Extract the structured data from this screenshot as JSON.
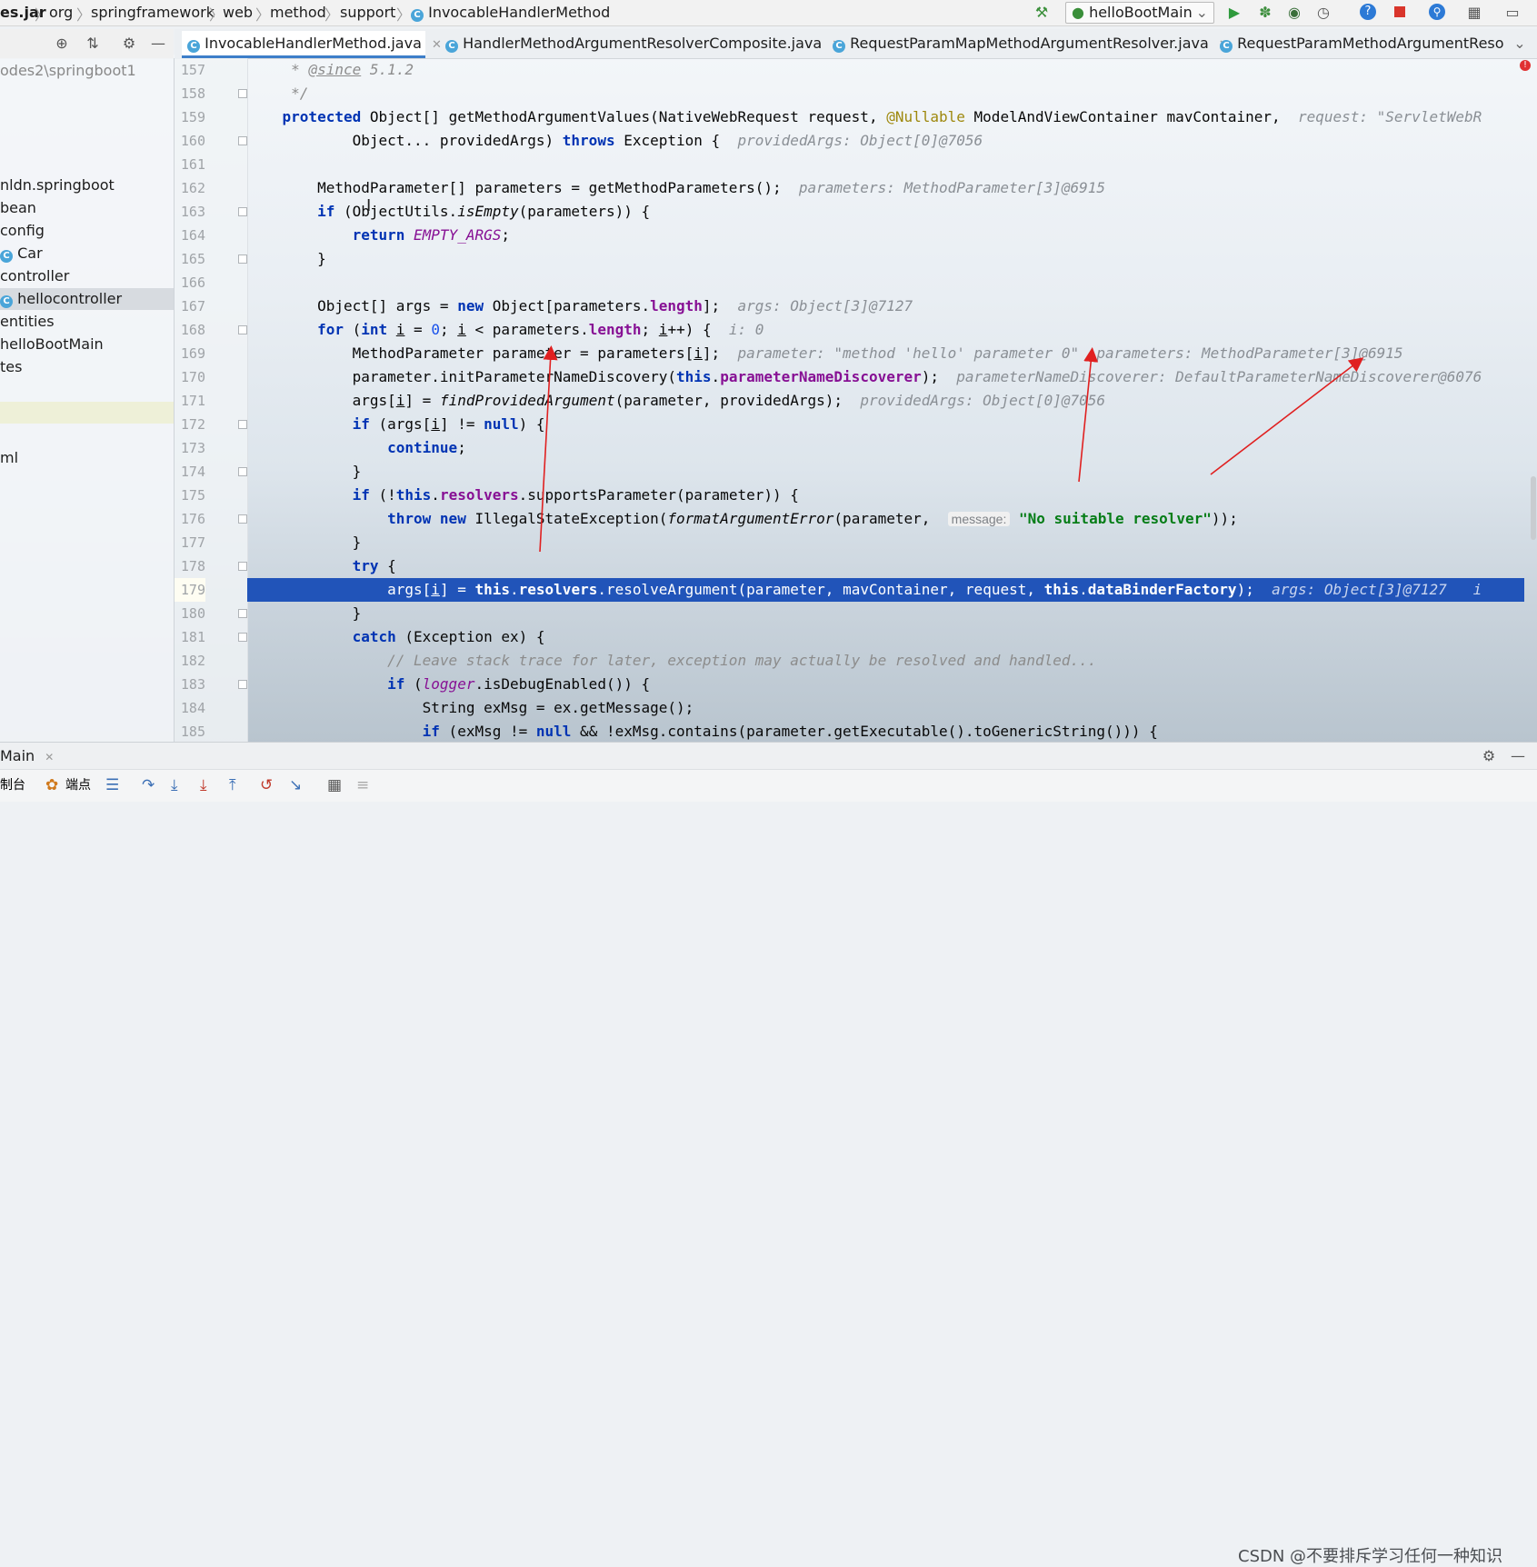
{
  "breadcrumb": {
    "items": [
      "es.jar",
      "org",
      "springframework",
      "web",
      "method",
      "support",
      "InvocableHandlerMethod"
    ],
    "separator": "〉"
  },
  "toolbar": {
    "run_config": "helloBootMain",
    "icons": [
      "hammer-icon",
      "run-icon",
      "debug-icon",
      "coverage-icon",
      "profile-icon",
      "help-icon",
      "stop-icon",
      "search-everywhere-icon",
      "project-structure-icon",
      "terminal-icon"
    ]
  },
  "sidebar": {
    "path": "odes2\\springboot1",
    "items": [
      {
        "label": "nldn.springboot"
      },
      {
        "label": "bean"
      },
      {
        "label": "config"
      },
      {
        "label": "Car"
      },
      {
        "label": "controller"
      },
      {
        "label": "hellocontroller"
      },
      {
        "label": "entities"
      },
      {
        "label": "helloBootMain"
      },
      {
        "label": "tes"
      },
      {
        "label": "ml"
      }
    ]
  },
  "tabs": [
    {
      "label": "InvocableHandlerMethod.java",
      "active": true
    },
    {
      "label": "HandlerMethodArgumentResolverComposite.java",
      "active": false
    },
    {
      "label": "RequestParamMapMethodArgumentResolver.java",
      "active": false
    },
    {
      "label": "RequestParamMethodArgumentResolve",
      "active": false
    }
  ],
  "editor": {
    "line_numbers": [
      "157",
      "158",
      "159",
      "160",
      "161",
      "162",
      "163",
      "164",
      "165",
      "166",
      "167",
      "168",
      "169",
      "170",
      "171",
      "172",
      "173",
      "174",
      "175",
      "176",
      "177",
      "178",
      "179",
      "180",
      "181",
      "182",
      "183",
      "184",
      "185"
    ],
    "current_line": "179",
    "hints": {
      "l159": "request: \"ServletWebR",
      "l160": "providedArgs: Object[0]@7056",
      "l162": "parameters: MethodParameter[3]@6915",
      "l167": "args: Object[3]@7127",
      "l168": "i: 0",
      "l169a": "parameter: \"method 'hello' parameter 0\"",
      "l169b": "parameters: MethodParameter[3]@6915",
      "l170": "parameterNameDiscoverer: DefaultParameterNameDiscoverer@6076",
      "l171": "providedArgs: Object[0]@7056",
      "l176": "message:",
      "l179": "args: Object[3]@7127   i"
    }
  },
  "debug_panel": {
    "tab_label": "Main",
    "toolbar_labels": [
      "制台",
      "端点"
    ]
  },
  "watermark": "CSDN @不要排斥学习任何一种知识",
  "colors": {
    "keyword": "#0033b3",
    "field": "#871094",
    "string": "#067d17",
    "current_line": "#2154b9",
    "arrow": "#e02020"
  }
}
